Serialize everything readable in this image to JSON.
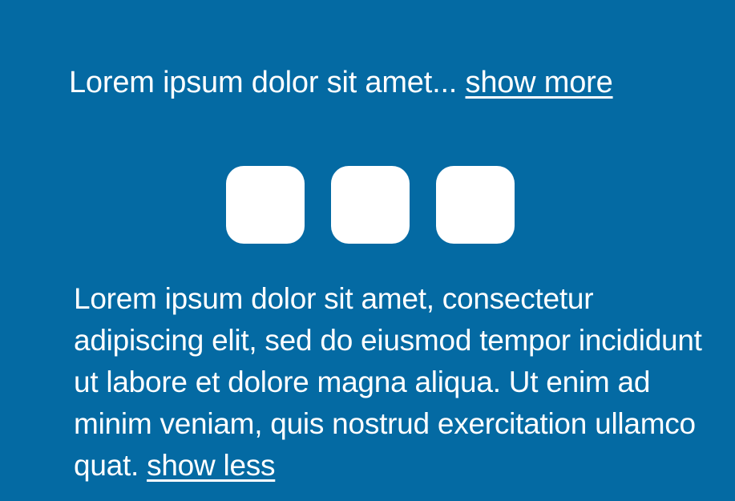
{
  "collapsed": {
    "text": "Lorem ipsum dolor sit amet...",
    "link": "show more"
  },
  "loader": {
    "count": 3,
    "color": "#ffffff"
  },
  "expanded": {
    "text": "Lorem ipsum dolor sit amet, consectetur adipiscing elit, sed do eiusmod tempor incididunt ut labore et dolore magna aliqua. Ut enim ad minim veniam, quis nostrud exercitation ullamco quat.",
    "link": "show less"
  },
  "colors": {
    "background": "#046aa3",
    "text": "#ffffff"
  }
}
